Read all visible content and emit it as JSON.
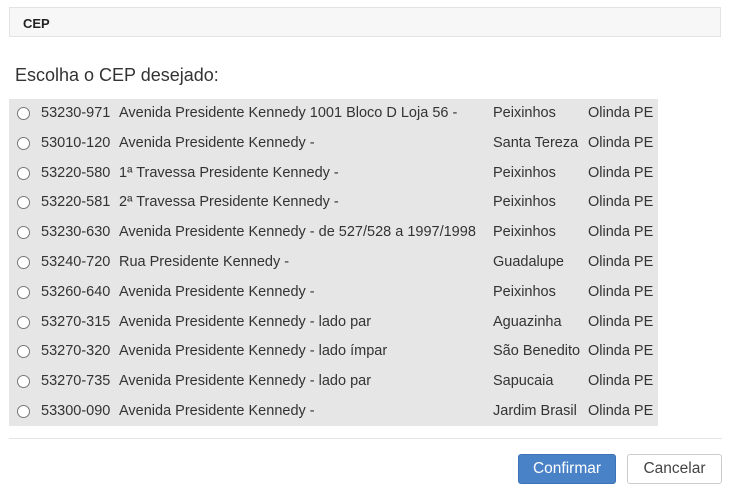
{
  "header": {
    "title": "CEP"
  },
  "prompt": "Escolha o CEP desejado:",
  "options": [
    {
      "cep": "53230-971",
      "street": "Avenida Presidente Kennedy 1001 Bloco D Loja 56 -",
      "bairro": "Peixinhos",
      "cidade": "Olinda",
      "uf": "PE"
    },
    {
      "cep": "53010-120",
      "street": "Avenida Presidente Kennedy -",
      "bairro": "Santa Tereza",
      "cidade": "Olinda",
      "uf": "PE"
    },
    {
      "cep": "53220-580",
      "street": "1ª Travessa Presidente Kennedy -",
      "bairro": "Peixinhos",
      "cidade": "Olinda",
      "uf": "PE"
    },
    {
      "cep": "53220-581",
      "street": "2ª Travessa Presidente Kennedy -",
      "bairro": "Peixinhos",
      "cidade": "Olinda",
      "uf": "PE"
    },
    {
      "cep": "53230-630",
      "street": "Avenida Presidente Kennedy - de 527/528 a 1997/1998",
      "bairro": "Peixinhos",
      "cidade": "Olinda",
      "uf": "PE"
    },
    {
      "cep": "53240-720",
      "street": "Rua Presidente Kennedy -",
      "bairro": "Guadalupe",
      "cidade": "Olinda",
      "uf": "PE"
    },
    {
      "cep": "53260-640",
      "street": "Avenida Presidente Kennedy -",
      "bairro": "Peixinhos",
      "cidade": "Olinda",
      "uf": "PE"
    },
    {
      "cep": "53270-315",
      "street": "Avenida Presidente Kennedy - lado par",
      "bairro": "Aguazinha",
      "cidade": "Olinda",
      "uf": "PE"
    },
    {
      "cep": "53270-320",
      "street": "Avenida Presidente Kennedy - lado ímpar",
      "bairro": "São Benedito",
      "cidade": "Olinda",
      "uf": "PE"
    },
    {
      "cep": "53270-735",
      "street": "Avenida Presidente Kennedy - lado par",
      "bairro": "Sapucaia",
      "cidade": "Olinda",
      "uf": "PE"
    },
    {
      "cep": "53300-090",
      "street": "Avenida Presidente Kennedy -",
      "bairro": "Jardim Brasil",
      "cidade": "Olinda",
      "uf": "PE"
    }
  ],
  "buttons": {
    "confirm": "Confirmar",
    "cancel": "Cancelar"
  },
  "colors": {
    "primary": "#4a82c8",
    "list_background": "#e6e6e6"
  }
}
